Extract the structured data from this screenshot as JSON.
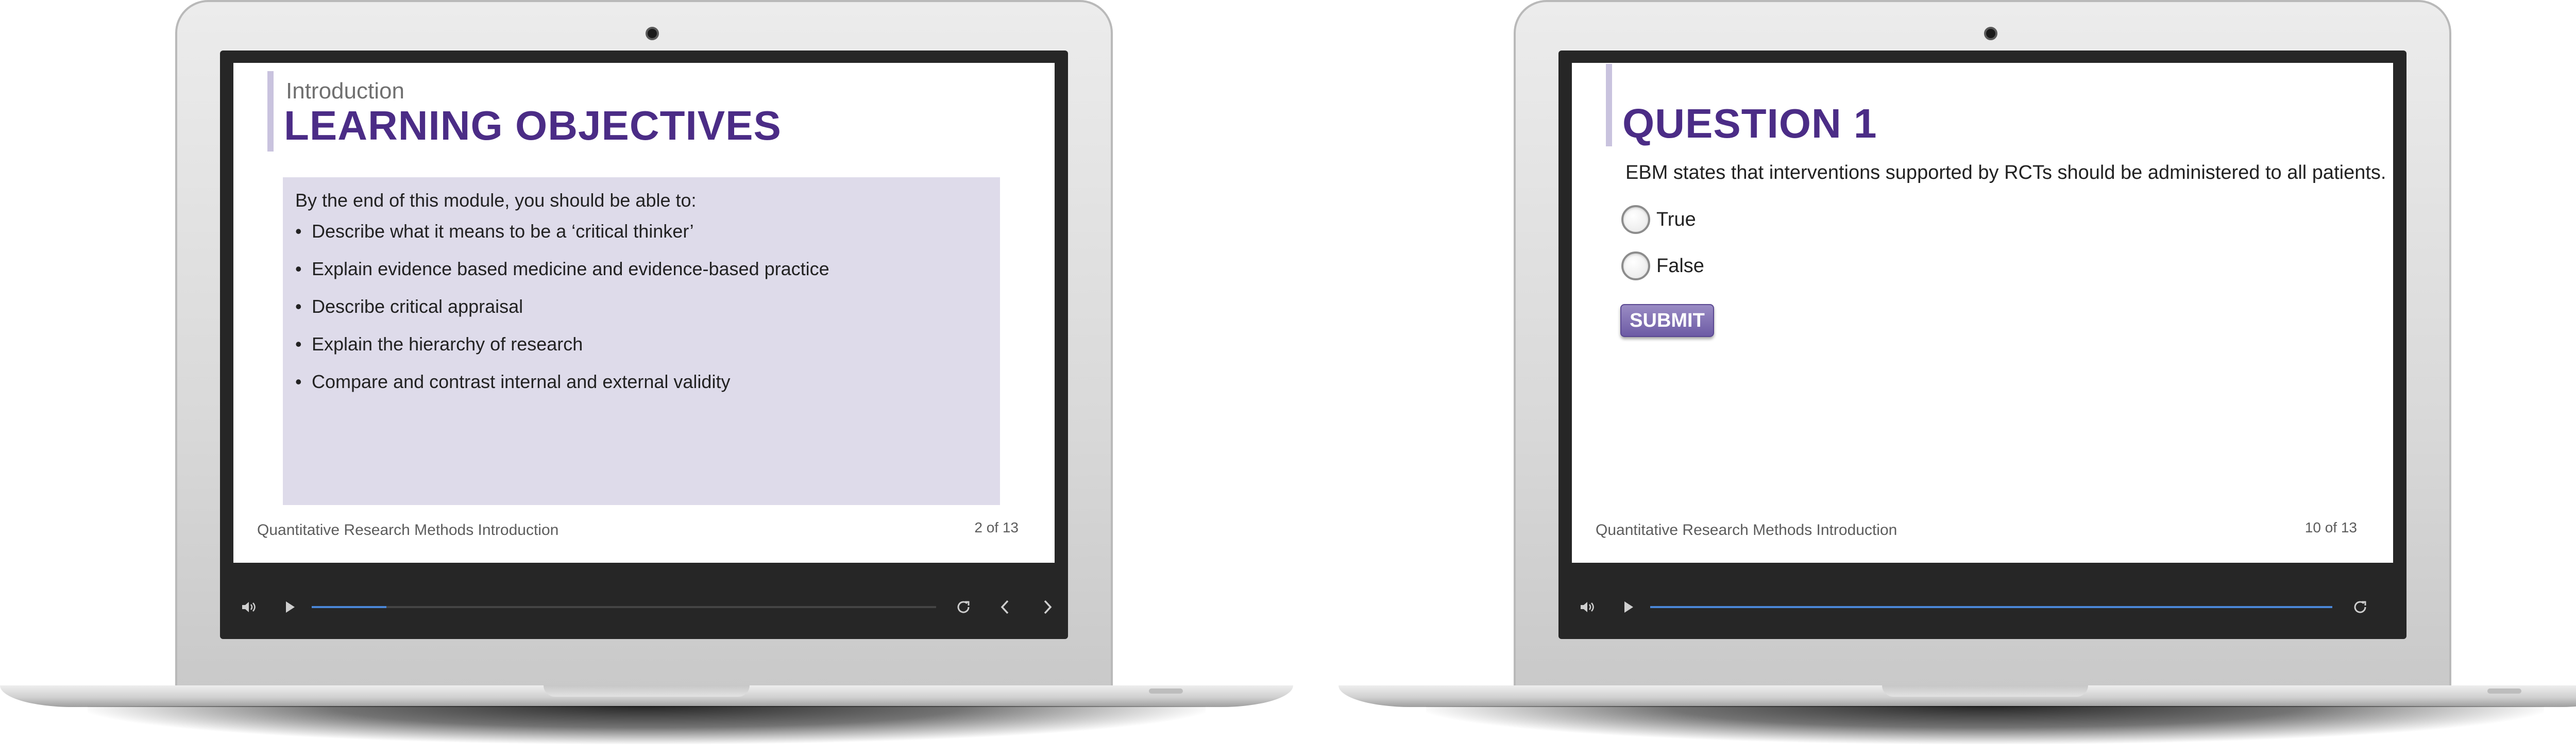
{
  "left_device": {
    "slide": {
      "subtitle": "Introduction",
      "title": "LEARNING OBJECTIVES",
      "intro": "By the end of this module, you should be able to:",
      "objectives": [
        "Describe what it means to be a ‘critical thinker’",
        "Explain evidence based medicine and evidence-based practice",
        "Describe critical appraisal",
        "Explain the hierarchy of research",
        "Compare and contrast internal and external validity"
      ],
      "footer": "Quantitative Research Methods Introduction",
      "page": "2 of 13"
    },
    "player": {
      "progress": 0.12,
      "icons": [
        "volume-icon",
        "play-icon",
        "replay-icon",
        "previous-icon",
        "next-icon"
      ]
    }
  },
  "right_device": {
    "slide": {
      "title": "QUESTION 1",
      "question": "EBM states that interventions supported by RCTs should be administered to all patients.",
      "options": [
        "True",
        "False"
      ],
      "submit_label": "SUBMIT",
      "footer": "Quantitative Research Methods Introduction",
      "page": "10 of 13"
    },
    "player": {
      "progress": 1.0,
      "icons": [
        "volume-icon",
        "play-icon",
        "replay-icon"
      ]
    }
  },
  "colors": {
    "title": "#4b2c86",
    "accent_bar": "#c9c3de",
    "content_box": "#dedbea",
    "progress": "#4a86d6",
    "submit": "#7a68b0",
    "bezel": "#262626"
  }
}
